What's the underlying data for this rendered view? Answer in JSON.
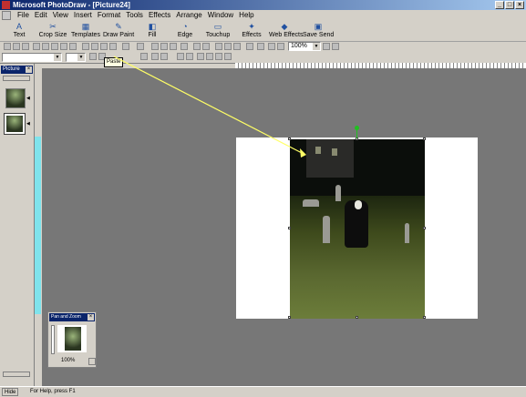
{
  "window": {
    "title": "Microsoft PhotoDraw - [Picture24]"
  },
  "menu": [
    "File",
    "Edit",
    "View",
    "Insert",
    "Format",
    "Tools",
    "Effects",
    "Arrange",
    "Window",
    "Help"
  ],
  "visual_menu": [
    {
      "label": "Text",
      "icon": "text-icon"
    },
    {
      "label": "Crop Size",
      "icon": "crop-icon"
    },
    {
      "label": "Templates",
      "icon": "templates-icon"
    },
    {
      "label": "Draw Paint",
      "icon": "draw-paint-icon"
    },
    {
      "label": "Fill",
      "icon": "fill-icon"
    },
    {
      "label": "Edge",
      "icon": "edge-icon"
    },
    {
      "label": "Touchup",
      "icon": "touchup-icon"
    },
    {
      "label": "Effects",
      "icon": "effects-icon"
    },
    {
      "label": "Web Effects",
      "icon": "web-effects-icon"
    },
    {
      "label": "Save Send",
      "icon": "save-send-icon"
    }
  ],
  "toolbar": {
    "zoom_value": "100%",
    "tooltip": "Paste"
  },
  "picture_list": {
    "title": "Picture"
  },
  "pan_zoom": {
    "title": "Pan and Zoom",
    "zoom": "100%"
  },
  "status": {
    "hide_label": "Hide",
    "message": "For Help, press F1"
  }
}
